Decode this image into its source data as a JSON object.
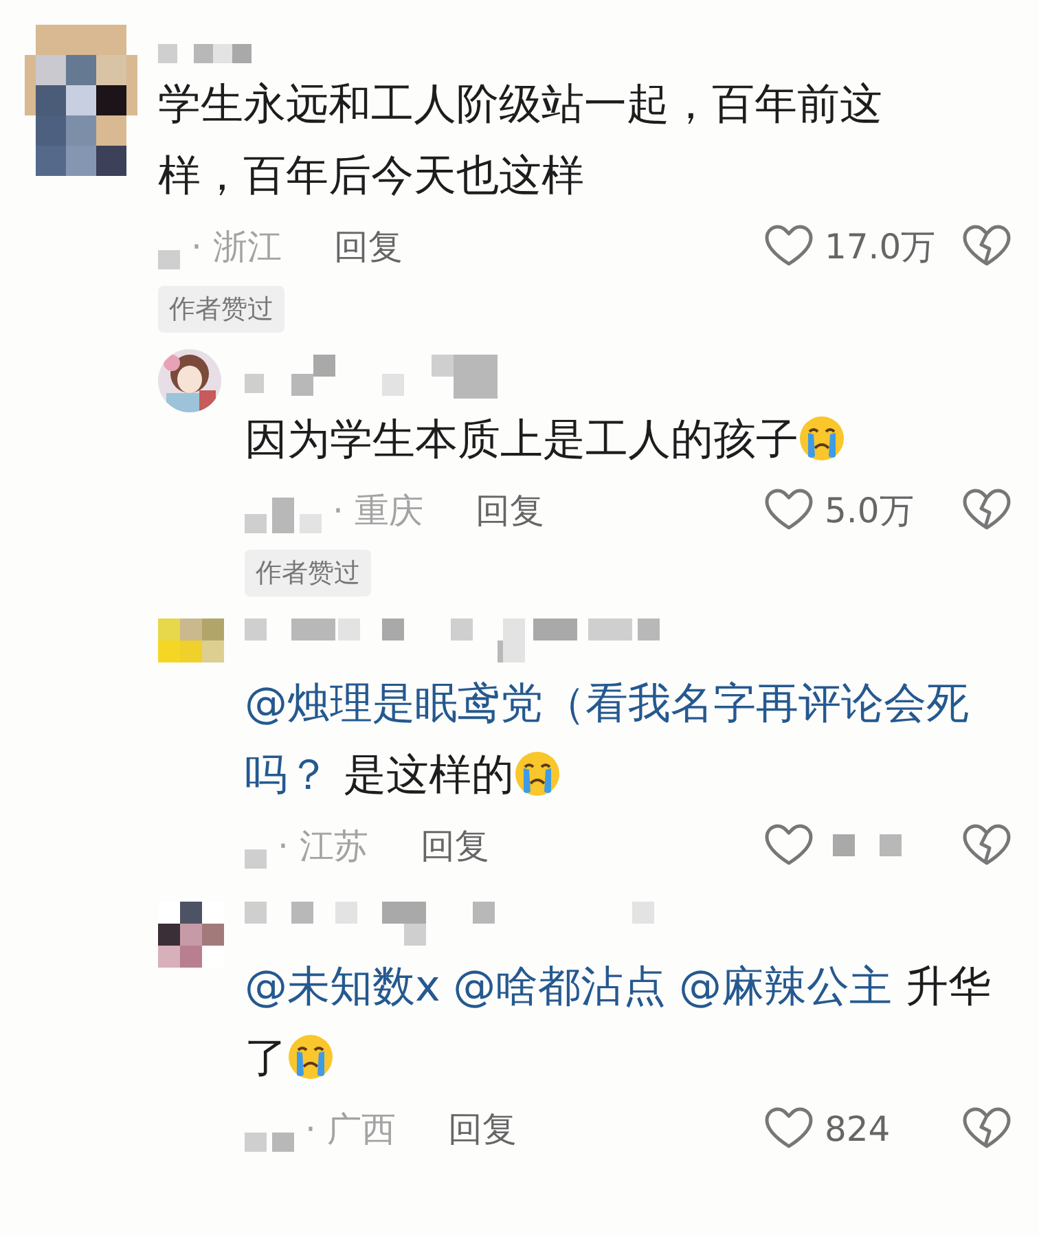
{
  "comments": [
    {
      "body": [
        {
          "kind": "text",
          "text": "学生永远和工人阶级站一起，百年前这样，百年后今天也这样"
        }
      ],
      "region": "· 浙江",
      "reply": "回复",
      "likes": "17.0万",
      "badge": "作者赞过",
      "replies": [
        {
          "body": [
            {
              "kind": "text",
              "text": "因为学生本质上是工人的孩子"
            },
            {
              "kind": "emoji"
            }
          ],
          "region": "· 重庆",
          "reply": "回复",
          "likes": "5.0万",
          "badge": "作者赞过"
        },
        {
          "body": [
            {
              "kind": "mention",
              "text": "@烛理是眠鸢党（看我名字再评论会死吗？"
            },
            {
              "kind": "text",
              "text": " 是这样的"
            },
            {
              "kind": "emoji"
            }
          ],
          "region": "· 江苏",
          "reply": "回复"
        },
        {
          "body": [
            {
              "kind": "mention",
              "text": "@未知数x"
            },
            {
              "kind": "mention",
              "text": "@啥都沾点"
            },
            {
              "kind": "mention",
              "text": "@麻辣公主"
            },
            {
              "kind": "text",
              "text": " 升华了"
            },
            {
              "kind": "emoji"
            }
          ],
          "region": "· 广西",
          "reply": "回复",
          "likes": "824"
        }
      ]
    }
  ]
}
